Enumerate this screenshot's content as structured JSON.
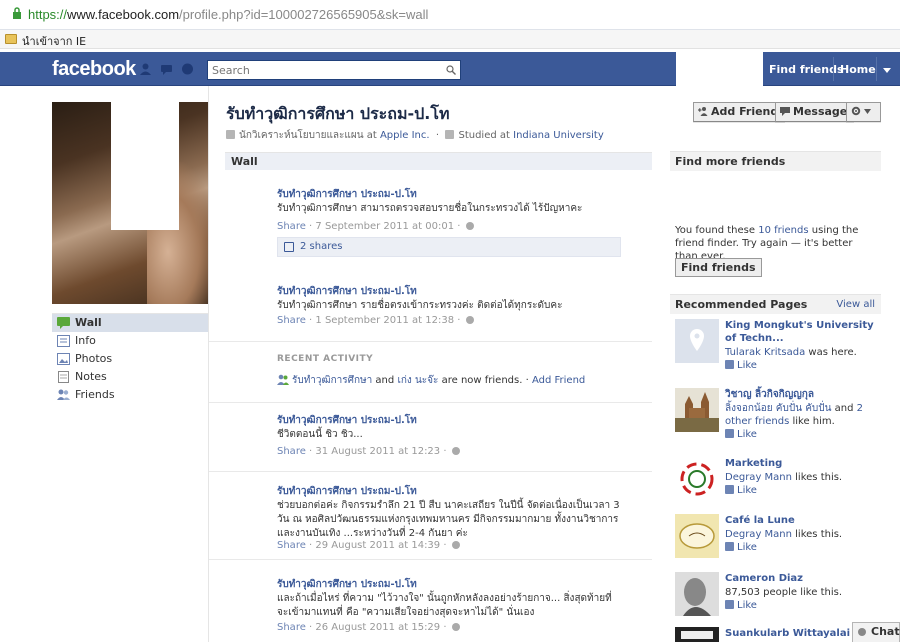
{
  "browser": {
    "url_scheme": "https://",
    "url_host": "www.facebook.com",
    "url_path": "/profile.php?id=100002726565905&sk=wall",
    "favorites_label": "นำเข้าจาก IE"
  },
  "topbar": {
    "logo": "facebook",
    "search_placeholder": "Search",
    "find_friends": "Find friends",
    "home": "Home",
    "color": "#3b5998"
  },
  "left_nav": [
    {
      "label": "Wall",
      "icon": "wall-icon",
      "active": true
    },
    {
      "label": "Info",
      "icon": "info-icon",
      "active": false
    },
    {
      "label": "Photos",
      "icon": "photos-icon",
      "active": false
    },
    {
      "label": "Notes",
      "icon": "notes-icon",
      "active": false
    },
    {
      "label": "Friends",
      "icon": "friends-icon",
      "active": false
    }
  ],
  "profile": {
    "name": "รับทำวุฒิการศึกษา ประถม-ป.โท",
    "work_prefix": "นักวิเคราะห์นโยบายและแผน at",
    "work_place": "Apple Inc.",
    "studied_prefix": "Studied at",
    "school": "Indiana University"
  },
  "buttons": {
    "add_friend": "Add Friend",
    "message": "Message"
  },
  "wall_header": "Wall",
  "stories": [
    {
      "author": "รับทำวุฒิการศึกษา ประถม-ป.โท",
      "message": "รับทำวุฒิการศึกษา สามารถตรวจสอบรายชื่อในกระทรวงได้ ไร้ปัญหาคะ",
      "share": "Share",
      "time": "7 September 2011 at 00:01",
      "shares": "2 shares"
    },
    {
      "author": "รับทำวุฒิการศึกษา ประถม-ป.โท",
      "message": "รับทำวุฒิการศึกษา รายชื่อตรงเข้ากระทรวงค่ะ ติดต่อได้ทุกระดับคะ",
      "share": "Share",
      "time": "1 September 2011 at 12:38"
    },
    {
      "author": "รับทำวุฒิการศึกษา ประถม-ป.โท",
      "message": "ชีวิตตอนนี้ ชิว ชิว...",
      "share": "Share",
      "time": "31 August 2011 at 12:23"
    },
    {
      "author": "รับทำวุฒิการศึกษา ประถม-ป.โท",
      "message": "ช่วยบอกต่อค่ะ กิจกรรมรำลึก 21 ปี สืบ นาคะเสถียร ในปีนี้ จัดต่อเนื่องเป็นเวลา 3 วัน ณ หอศิลปวัฒนธรรมแห่งกรุงเทพมหานคร มีกิจกรรมมากมาย ทั้งงานวิชาการ และงานบันเทิง ...ระหว่างวันที่ 2-4 กันยา ค่ะ",
      "share": "Share",
      "time": "29 August 2011 at 14:39"
    },
    {
      "author": "รับทำวุฒิการศึกษา ประถม-ป.โท",
      "message": "และถ้าเมื่อไหร่ ที่ความ \"ไว้วางใจ\" นั้นถูกหักหลังลงอย่างร้ายกาจ... สิ่งสุดท้ายที่จะเข้ามาแทนที่ คือ \"ความเสียใจอย่างสุดจะหาไม่ได้\" นั่นเอง",
      "share": "Share",
      "time": "26 August 2011 at 15:29"
    }
  ],
  "recent_activity": {
    "header": "RECENT ACTIVITY",
    "actor": "รับทำวุฒิการศึกษา",
    "and": "and",
    "friend": "เก่ง นะจ๊ะ",
    "text": "are now friends.",
    "add_friend": "Add Friend"
  },
  "find_more": {
    "header": "Find more friends",
    "text_a": "You found these",
    "count_link": "10 friends",
    "text_b": "using the friend finder. Try again — it's better than ever.",
    "button": "Find friends"
  },
  "recommended": {
    "header": "Recommended Pages",
    "view_all": "View all",
    "like": "Like",
    "pages": [
      {
        "title": "King Mongkut's University of Techn...",
        "line_link": "Tularak Kritsada",
        "line_text": "was here."
      },
      {
        "title": "วิชาญ ลิ้วกิจกิญญกุล",
        "line_link": "ลิ้งจอกน้อย คับปั่น คับปั่น",
        "line_text": "and",
        "line_link2": "2 other friends",
        "line_text2": "like him."
      },
      {
        "title": "Marketing",
        "line_link": "Degray Mann",
        "line_text": "likes this."
      },
      {
        "title": "Café la Lune",
        "line_link": "Degray Mann",
        "line_text": "likes this."
      },
      {
        "title": "Cameron Diaz",
        "line_text": "87,503 people like this."
      },
      {
        "title": "Suankularb Wittayalai"
      }
    ]
  },
  "chat": "Chat"
}
